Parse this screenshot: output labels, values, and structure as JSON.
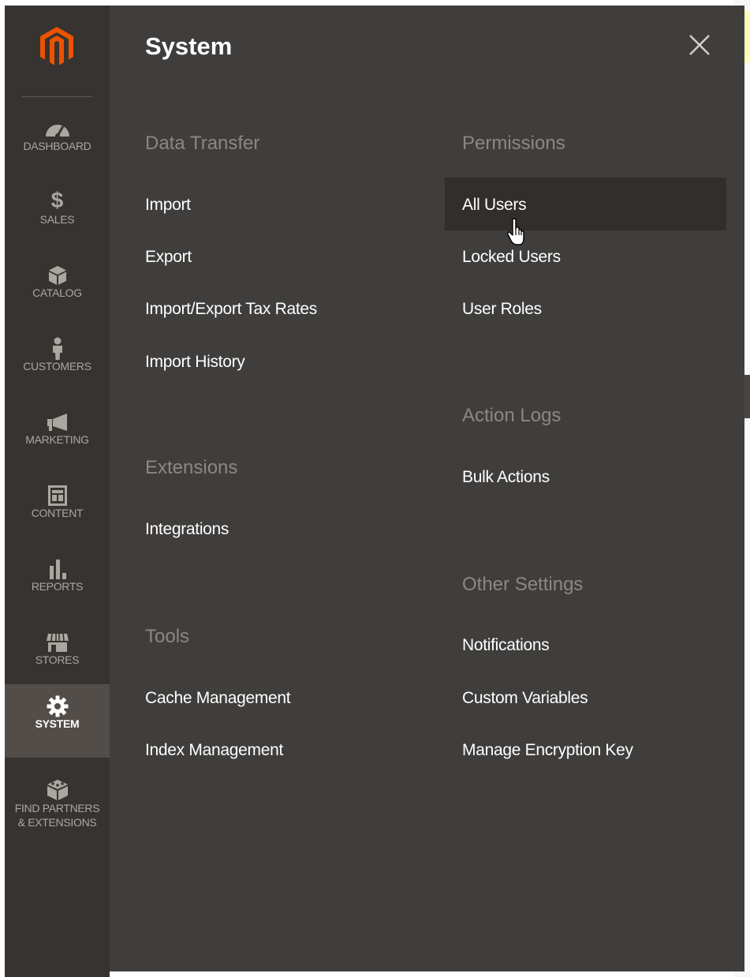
{
  "sidebar": {
    "items": [
      {
        "label": "DASHBOARD",
        "icon": "dashboard-icon"
      },
      {
        "label": "$",
        "sub": "SALES",
        "icon": "dollar-icon"
      },
      {
        "label": "CATALOG",
        "icon": "cube-icon"
      },
      {
        "label": "CUSTOMERS",
        "icon": "person-icon"
      },
      {
        "label": "MARKETING",
        "icon": "megaphone-icon"
      },
      {
        "label": "CONTENT",
        "icon": "layout-icon"
      },
      {
        "label": "REPORTS",
        "icon": "bar-chart-icon"
      },
      {
        "label": "STORES",
        "icon": "storefront-icon"
      },
      {
        "label": "SYSTEM",
        "icon": "gear-icon"
      },
      {
        "label_line1": "FIND PARTNERS",
        "label_line2": "& EXTENSIONS",
        "icon": "partners-cube-icon"
      }
    ]
  },
  "panel": {
    "title": "System",
    "sections_left": [
      {
        "title": "Data Transfer",
        "links": [
          "Import",
          "Export",
          "Import/Export Tax Rates",
          "Import History"
        ]
      },
      {
        "title": "Extensions",
        "links": [
          "Integrations"
        ]
      },
      {
        "title": "Tools",
        "links": [
          "Cache Management",
          "Index Management"
        ]
      }
    ],
    "sections_right": [
      {
        "title": "Permissions",
        "links": [
          "All Users",
          "Locked Users",
          "User Roles"
        ]
      },
      {
        "title": "Action Logs",
        "links": [
          "Bulk Actions"
        ]
      },
      {
        "title": "Other Settings",
        "links": [
          "Notifications",
          "Custom Variables",
          "Manage Encryption Key"
        ]
      }
    ],
    "hovered_link": "All Users"
  },
  "colors": {
    "sidebar_bg": "#373330",
    "panel_bg": "#403e3c",
    "active_bg": "#524d49",
    "logo_orange": "#eb5202",
    "section_title": "#8c8781"
  }
}
